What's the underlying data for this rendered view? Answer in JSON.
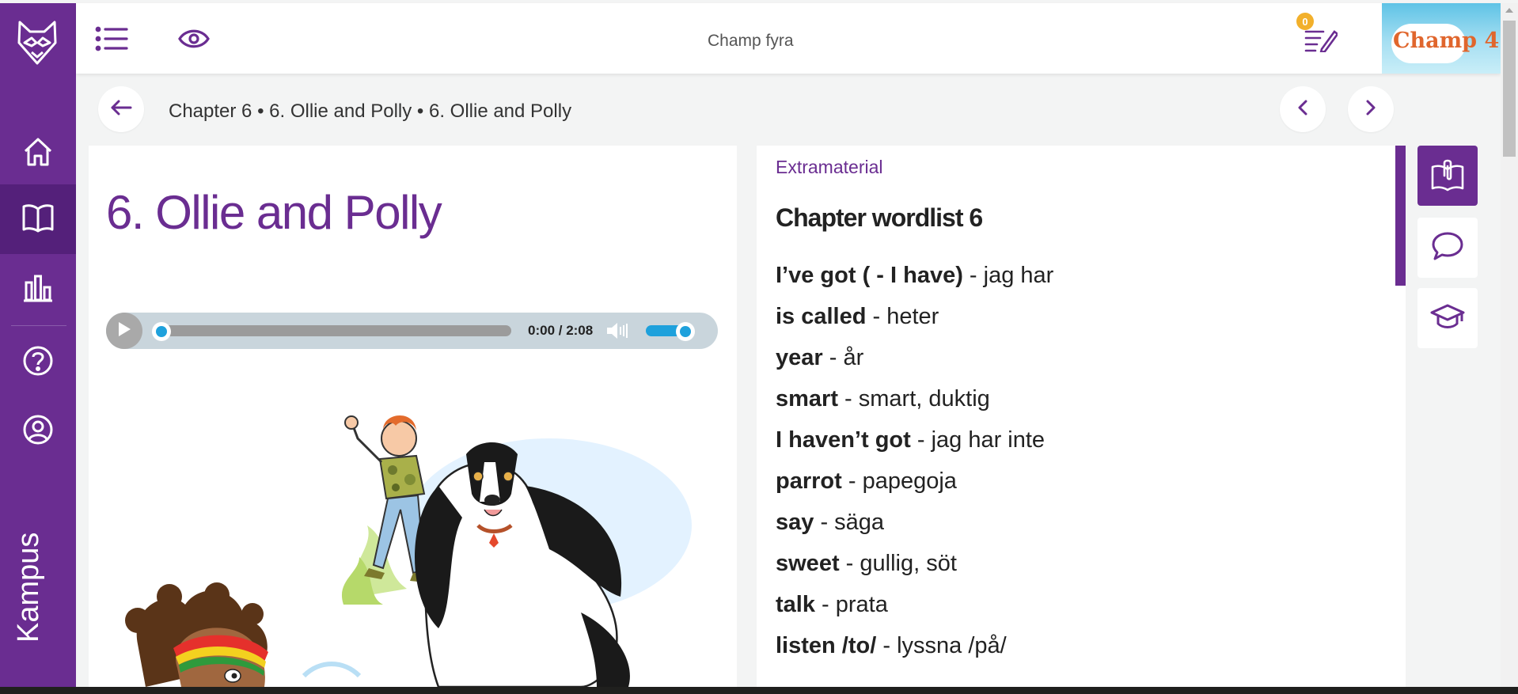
{
  "app": {
    "brand": "Kampus",
    "colors": {
      "primary": "#6a2d91",
      "accent_blue": "#1ea1dc",
      "badge": "#f2b02b"
    }
  },
  "topbar": {
    "title": "Champ fyra",
    "icons": [
      "list-icon",
      "eye-icon",
      "notes-icon"
    ],
    "notification_count": "0",
    "book_cover_text": "Champ 4"
  },
  "sidebar": {
    "items": [
      {
        "name": "home",
        "icon": "home-icon",
        "active": false
      },
      {
        "name": "books",
        "icon": "book-icon",
        "active": true
      },
      {
        "name": "statistics",
        "icon": "bar-chart-icon",
        "active": false
      },
      {
        "name": "help",
        "icon": "help-icon",
        "active": false
      },
      {
        "name": "profile",
        "icon": "user-icon",
        "active": false
      }
    ]
  },
  "breadcrumb": {
    "text": "Chapter 6 • 6. Ollie and Polly • 6. Ollie and Polly"
  },
  "content": {
    "title": "6. Ollie and Polly",
    "audio": {
      "time": "0:00 / 2:08",
      "progress": 0.0,
      "volume": 0.8
    }
  },
  "extramaterial": {
    "section_label": "Extramaterial",
    "title": "Chapter wordlist 6",
    "words": [
      {
        "en": "I’ve got ( - I have)",
        "sv": " - jag har"
      },
      {
        "en": "is called",
        "sv": " - heter"
      },
      {
        "en": "year",
        "sv": " - år"
      },
      {
        "en": "smart",
        "sv": " - smart, duktig"
      },
      {
        "en": "I haven’t got",
        "sv": " - jag har inte"
      },
      {
        "en": "parrot",
        "sv": " - papegoja"
      },
      {
        "en": "say",
        "sv": " - säga"
      },
      {
        "en": "sweet",
        "sv": " - gullig, söt"
      },
      {
        "en": "talk",
        "sv": " - prata"
      },
      {
        "en": "listen /to/",
        "sv": " - lyssna /på/"
      }
    ]
  },
  "side_tools": [
    {
      "name": "extramaterial",
      "icon": "book-clip-icon",
      "active": true
    },
    {
      "name": "comments",
      "icon": "chat-icon",
      "active": false
    },
    {
      "name": "course",
      "icon": "graduation-cap-icon",
      "active": false
    }
  ]
}
